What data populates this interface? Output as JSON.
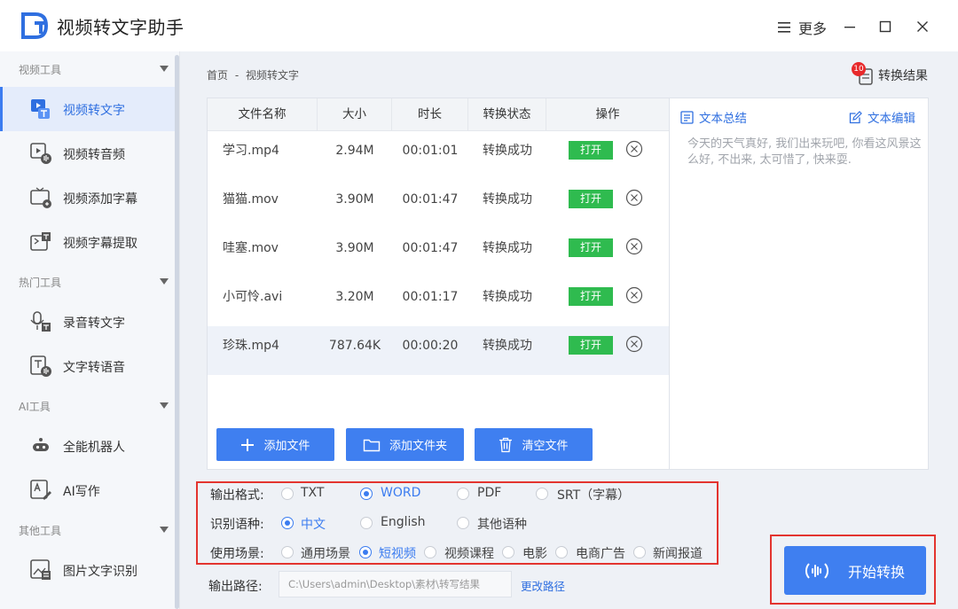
{
  "window": {
    "title": "视频转文字助手",
    "more_label": "更多"
  },
  "sidebar": {
    "sections": [
      {
        "label": "视频工具",
        "items": [
          "视频转文字",
          "视频转音频",
          "视频添加字幕",
          "视频字幕提取"
        ]
      },
      {
        "label": "热门工具",
        "items": [
          "录音转文字",
          "文字转语音"
        ]
      },
      {
        "label": "AI工具",
        "items": [
          "全能机器人",
          "AI写作"
        ]
      },
      {
        "label": "其他工具",
        "items": [
          "图片文字识别"
        ]
      }
    ],
    "active_item": "视频转文字"
  },
  "breadcrumb": {
    "home": "首页",
    "separator": "-",
    "current": "视频转文字"
  },
  "result": {
    "badge": "10",
    "label": "转换结果"
  },
  "table": {
    "headers": [
      "文件名称",
      "大小",
      "时长",
      "转换状态",
      "操作"
    ],
    "rows": [
      {
        "name": "学习.mp4",
        "size": "2.94M",
        "duration": "00:01:01",
        "status": "转换成功",
        "open": "打开"
      },
      {
        "name": "猫猫.mov",
        "size": "3.90M",
        "duration": "00:01:47",
        "status": "转换成功",
        "open": "打开"
      },
      {
        "name": "哇塞.mov",
        "size": "3.90M",
        "duration": "00:01:47",
        "status": "转换成功",
        "open": "打开"
      },
      {
        "name": "小可怜.avi",
        "size": "3.20M",
        "duration": "00:01:17",
        "status": "转换成功",
        "open": "打开"
      },
      {
        "name": "珍珠.mp4",
        "size": "787.64K",
        "duration": "00:00:20",
        "status": "转换成功",
        "open": "打开"
      }
    ]
  },
  "file_actions": {
    "add_file": "添加文件",
    "add_folder": "添加文件夹",
    "clear": "清空文件"
  },
  "text_panel": {
    "summary_label": "文本总结",
    "edit_label": "文本编辑",
    "content": "今天的天气真好, 我们出来玩吧, 你看这风景这么好, 不出来, 太可惜了, 快来耍."
  },
  "options": {
    "format": {
      "label": "输出格式:",
      "choices": [
        "TXT",
        "WORD",
        "PDF",
        "SRT（字幕）"
      ],
      "selected": "WORD"
    },
    "language": {
      "label": "识别语种:",
      "choices": [
        "中文",
        "English",
        "其他语种"
      ],
      "selected": "中文"
    },
    "scene": {
      "label": "使用场景:",
      "choices": [
        "通用场景",
        "短视频",
        "视频课程",
        "电影",
        "电商广告",
        "新闻报道"
      ],
      "selected": "短视频"
    }
  },
  "output": {
    "label": "输出路径:",
    "path": "C:\\Users\\admin\\Desktop\\素材\\转写结果",
    "change_label": "更改路径"
  },
  "start_button": {
    "label": "开始转换"
  },
  "colors": {
    "accent": "#3f7ff0",
    "success": "#2fbb4f",
    "highlight_border": "#e3342f",
    "badge": "#e8292b"
  }
}
